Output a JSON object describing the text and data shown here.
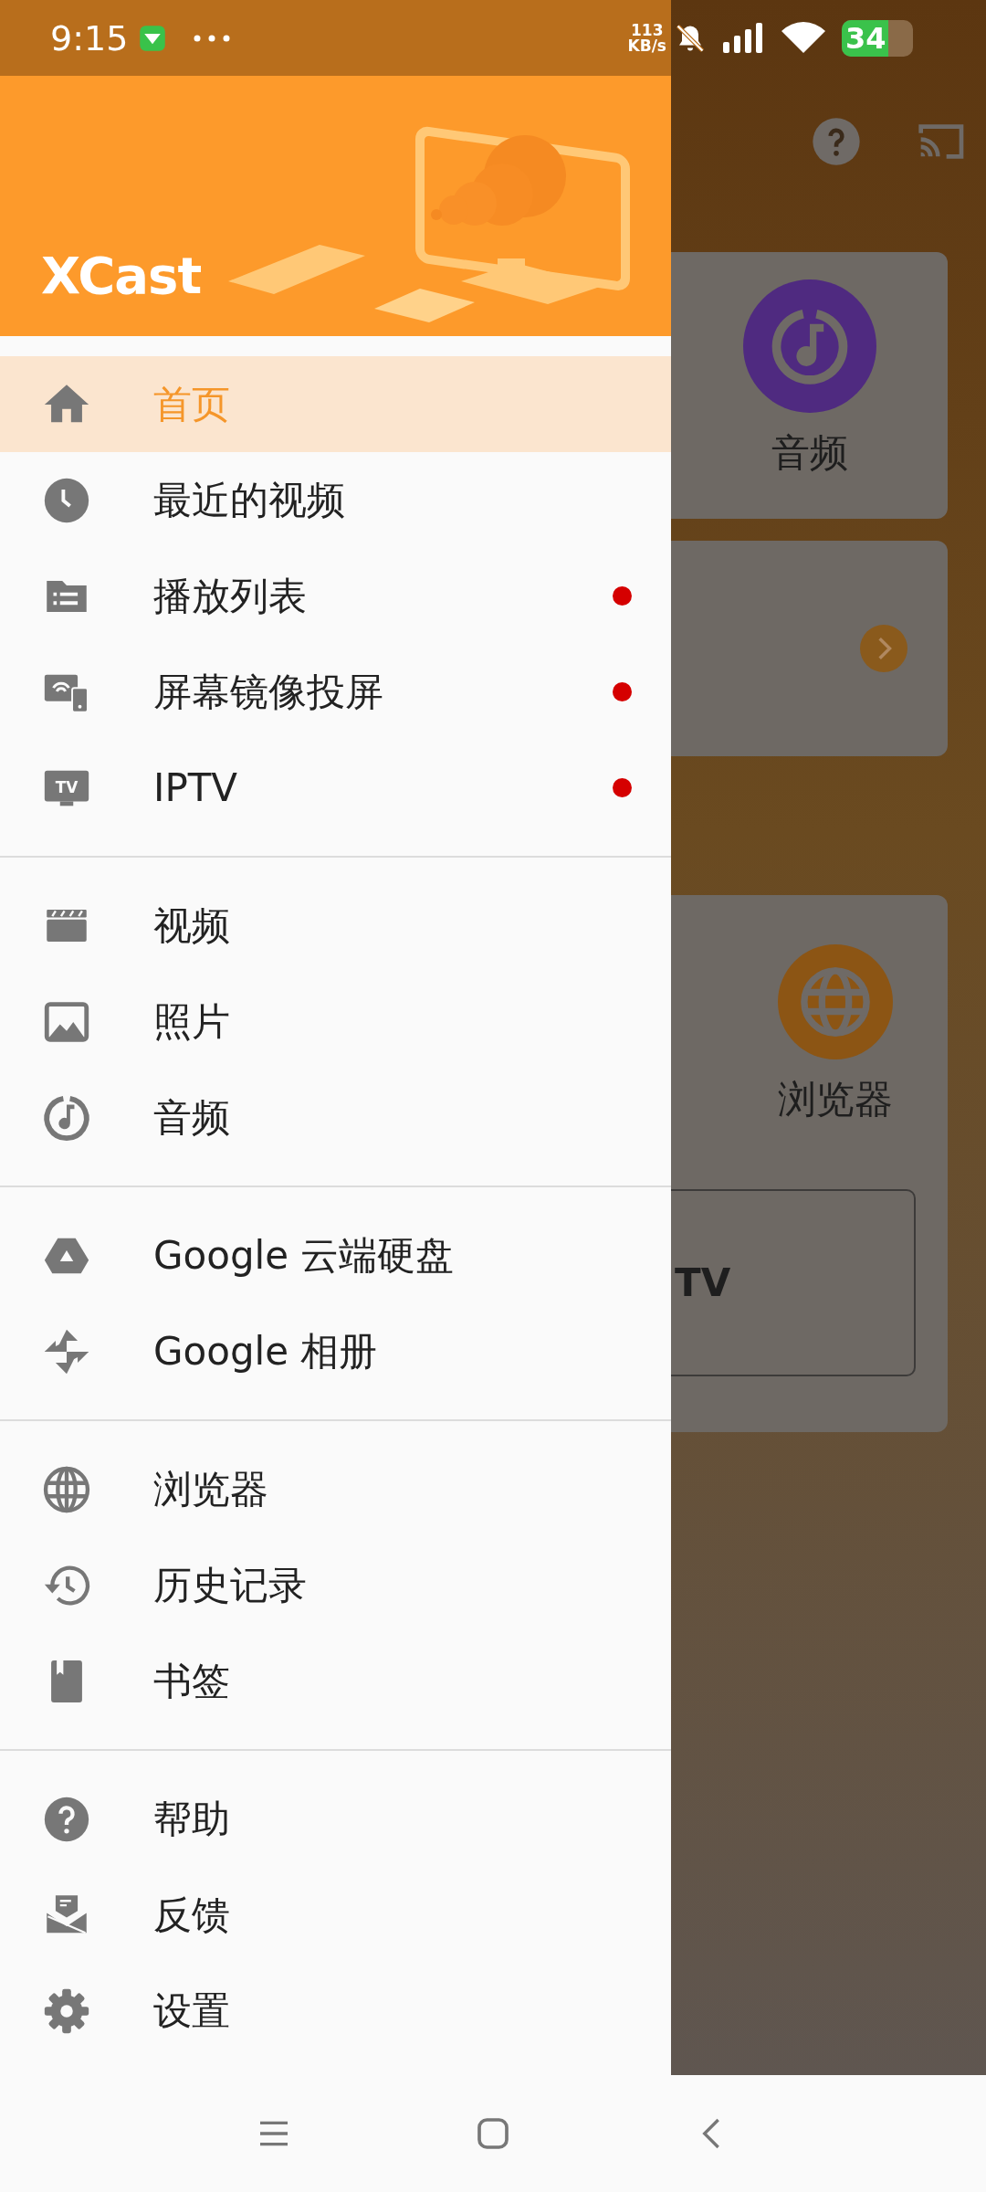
{
  "status_bar": {
    "time": "9:15",
    "net_speed": "113",
    "net_unit": "KB/s",
    "battery": "34"
  },
  "drawer": {
    "logo": "XCast",
    "groups": [
      {
        "items": [
          {
            "kind": "home",
            "label": "首页",
            "selected": true,
            "dot": false
          },
          {
            "kind": "clock",
            "label": "最近的视频",
            "selected": false,
            "dot": false
          },
          {
            "kind": "playlist",
            "label": "播放列表",
            "selected": false,
            "dot": true
          },
          {
            "kind": "mirror",
            "label": "屏幕镜像投屏",
            "selected": false,
            "dot": true
          },
          {
            "kind": "tv",
            "icon_label": "TV",
            "label": "IPTV",
            "selected": false,
            "dot": true
          }
        ]
      },
      {
        "items": [
          {
            "kind": "video",
            "label": "视频",
            "selected": false,
            "dot": false
          },
          {
            "label": "照片",
            "selected": false,
            "dot": false
          },
          {
            "kind": "audio",
            "label": "音频",
            "selected": false,
            "dot": false
          }
        ]
      },
      {
        "items": [
          {
            "kind": "drive",
            "label": "Google 云端硬盘",
            "selected": false,
            "dot": false
          },
          {
            "kind": "photos",
            "label": "Google 相册",
            "selected": false,
            "dot": false
          }
        ]
      },
      {
        "items": [
          {
            "kind": "globe",
            "label": "浏览器",
            "selected": false,
            "dot": false
          },
          {
            "kind": "history",
            "label": "历史记录",
            "selected": false,
            "dot": false
          },
          {
            "kind": "bookmark",
            "label": "书签",
            "selected": false,
            "dot": false
          }
        ]
      },
      {
        "items": [
          {
            "kind": "help",
            "label": "帮助",
            "selected": false,
            "dot": false
          },
          {
            "kind": "feedback",
            "label": "反馈",
            "selected": false,
            "dot": false
          },
          {
            "kind": "settings",
            "label": "设置",
            "selected": false,
            "dot": false
          }
        ]
      }
    ]
  },
  "background_app": {
    "tiles": [
      {
        "kind": "audio",
        "label": "音频"
      },
      {
        "kind": "arrow"
      },
      {
        "kind": "browser",
        "label": "浏览器"
      }
    ],
    "iptv_button": {
      "label": "TV"
    }
  }
}
